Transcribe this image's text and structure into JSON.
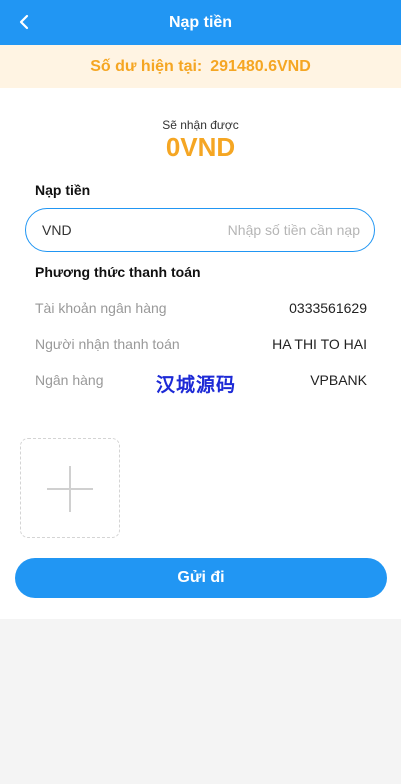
{
  "header": {
    "title": "Nạp tiền",
    "back_icon": "chevron-left-icon"
  },
  "balance": {
    "label": "Số dư hiện tại:",
    "value": "291480.6VND"
  },
  "receive": {
    "label": "Sẽ nhận được",
    "amount": "0VND"
  },
  "deposit": {
    "section_title": "Nạp tiền",
    "currency": "VND",
    "input_value": "",
    "placeholder": "Nhập số tiền cần nạp"
  },
  "payment": {
    "section_title": "Phương thức thanh toán",
    "rows": [
      {
        "label": "Tài khoản ngân hàng",
        "value": "0333561629"
      },
      {
        "label": "Người nhận thanh toán",
        "value": "HA THI TO HAI"
      },
      {
        "label": "Ngân hàng",
        "value": "VPBANK"
      }
    ]
  },
  "watermark": "汉城源码",
  "upload": {
    "icon": "plus-icon"
  },
  "submit": {
    "label": "Gửi đi"
  },
  "colors": {
    "primary": "#2196f3",
    "accent": "#f5a623",
    "balance_bg": "#fff4e3"
  }
}
